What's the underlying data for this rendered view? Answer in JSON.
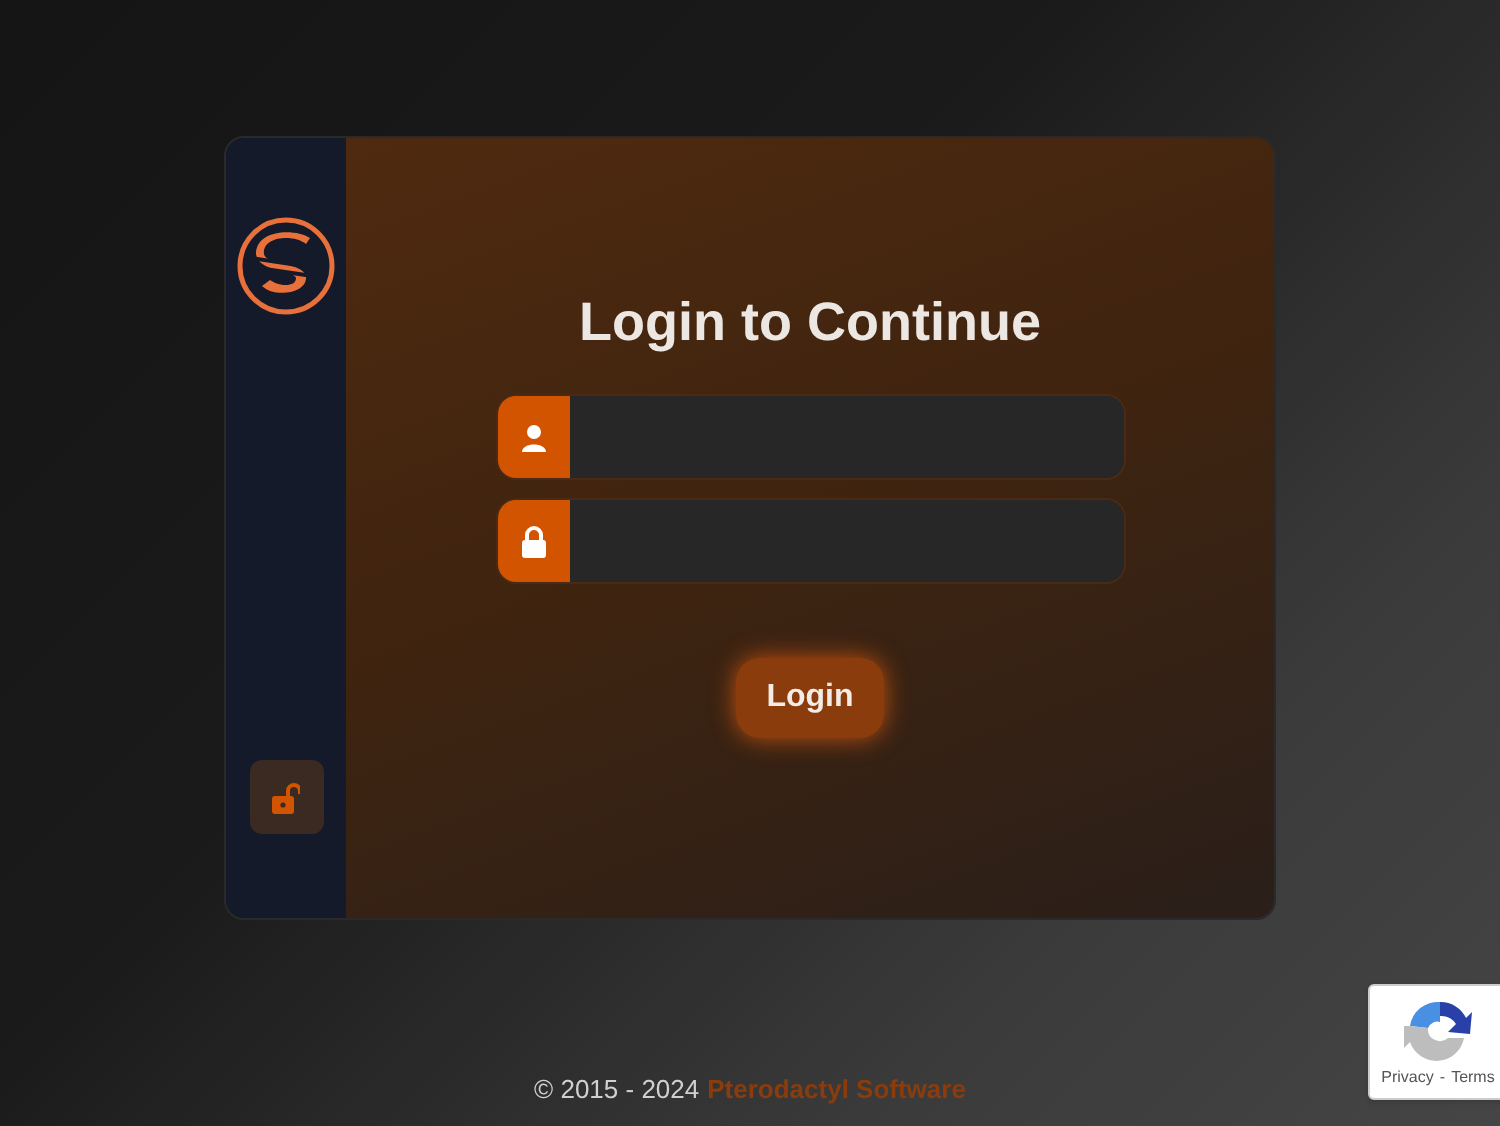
{
  "login_card": {
    "title": "Login to Continue",
    "fields": [
      {
        "kind": "username"
      },
      {
        "kind": "password"
      }
    ],
    "submit_button": "Login"
  },
  "footer": {
    "copyright": "© 2015 - 2024",
    "link": "Pterodactyl Software"
  },
  "recaptcha": {
    "privacy": "Privacy",
    "separator": "-",
    "terms": "Terms"
  }
}
